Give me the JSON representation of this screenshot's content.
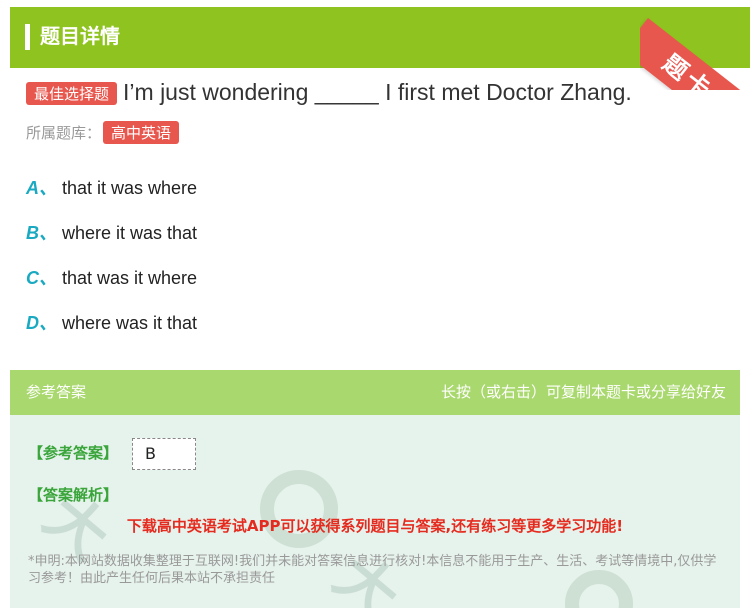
{
  "header": {
    "title": "题目详情",
    "ribbon_label": "题卡"
  },
  "question": {
    "type_tag": "最佳选择题",
    "text": "I’m just wondering _____ I first met Doctor Zhang.",
    "source_label": "所属题库：",
    "source_tag": "高中英语"
  },
  "options": [
    {
      "letter": "A、",
      "text": "that it was where"
    },
    {
      "letter": "B、",
      "text": "where it was that"
    },
    {
      "letter": "C、",
      "text": "that was it where"
    },
    {
      "letter": "D、",
      "text": "where was it that"
    }
  ],
  "answer_panel": {
    "left_title": "参考答案",
    "right_hint": "长按（或右击）可复制本题卡或分享给好友",
    "ref_label": "【参考答案】",
    "ref_value": "B",
    "analysis_label": "【答案解析】",
    "promo": "下载高中英语考试APP可以获得系列题目与答案,还有练习等更多学习功能!",
    "disclaimer": "*申明:本网站数据收集整理于互联网!我们并未能对答案信息进行核对!本信息不能用于生产、生活、考试等情境中,仅供学习参考！由此产生任何后果本站不承担责任"
  },
  "colors": {
    "green": "#8fc31f",
    "light_green": "#a9d86e",
    "red": "#e8574e",
    "teal": "#19a9c1"
  }
}
